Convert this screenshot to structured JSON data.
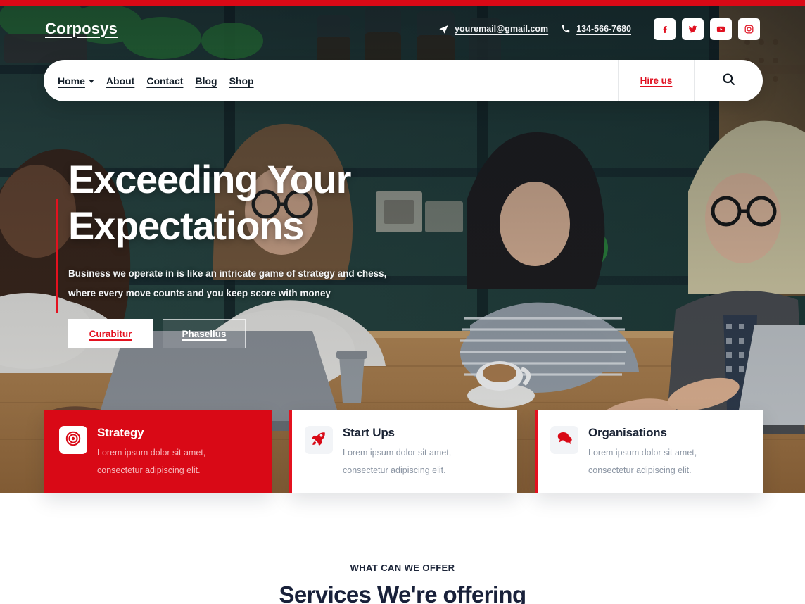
{
  "theme": {
    "red": "#d90916",
    "accent_red": "#e4111f",
    "navy": "#19213a"
  },
  "topbar": {
    "brand": "Corposys",
    "email": "youremail@gmail.com",
    "phone": "134-566-7680",
    "socials": [
      {
        "name": "facebook-icon",
        "label": "Facebook"
      },
      {
        "name": "twitter-icon",
        "label": "Twitter"
      },
      {
        "name": "youtube-icon",
        "label": "YouTube"
      },
      {
        "name": "instagram-icon",
        "label": "Instagram"
      }
    ]
  },
  "nav": {
    "items": [
      {
        "label": "Home",
        "has_dropdown": true
      },
      {
        "label": "About",
        "has_dropdown": false
      },
      {
        "label": "Contact",
        "has_dropdown": false
      },
      {
        "label": "Blog",
        "has_dropdown": false
      },
      {
        "label": "Shop",
        "has_dropdown": false
      }
    ],
    "cta_label": "Hire us",
    "search_icon": "search-icon"
  },
  "hero": {
    "title_line1": "Exceeding Your",
    "title_line2": "Expectations",
    "subtitle_line1": "Business we operate in is like an intricate game of strategy and chess,",
    "subtitle_line2": "where every move counts and you keep score with money",
    "primary_button": "Curabitur",
    "secondary_button": "Phasellus"
  },
  "cards": [
    {
      "title": "Strategy",
      "text_line1": "Lorem ipsum dolor sit amet,",
      "text_line2": "consectetur adipiscing elit.",
      "icon": "target-icon",
      "variant": "red"
    },
    {
      "title": "Start Ups",
      "text_line1": "Lorem ipsum dolor sit amet,",
      "text_line2": "consectetur adipiscing elit.",
      "icon": "rocket-icon",
      "variant": "white"
    },
    {
      "title": "Organisations",
      "text_line1": "Lorem ipsum dolor sit amet,",
      "text_line2": "consectetur adipiscing elit.",
      "icon": "chat-bubbles-icon",
      "variant": "white"
    }
  ],
  "services": {
    "eyebrow": "WHAT CAN WE OFFER",
    "title": "Services We're offering"
  }
}
